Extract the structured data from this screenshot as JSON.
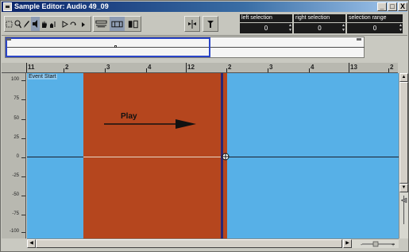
{
  "window": {
    "title": "Sample Editor: Audio 49_09",
    "minimize_label": "_",
    "maximize_label": "□",
    "close_label": "X"
  },
  "toolbar": {
    "tools": [
      {
        "name": "range-select-icon",
        "glyph": "⬚"
      },
      {
        "name": "zoom-icon",
        "glyph": "🔍"
      },
      {
        "name": "pencil-icon",
        "glyph": "✎"
      },
      {
        "name": "play-tool-icon",
        "glyph": "◁"
      },
      {
        "name": "scrub-icon",
        "glyph": "✋"
      },
      {
        "name": "audition-icon",
        "glyph": "♫"
      }
    ],
    "left_selection": {
      "label": "left selection",
      "value": "0"
    },
    "right_selection": {
      "label": "right selection",
      "value": "0"
    },
    "selection_range": {
      "label": "selection range",
      "value": "0"
    }
  },
  "ruler": {
    "marks": [
      "11",
      "2",
      "3",
      "4",
      "12",
      "2",
      "3",
      "4",
      "13",
      "2"
    ]
  },
  "scale": {
    "labels": [
      "100",
      "75",
      "50",
      "25",
      "0",
      "-25",
      "-50",
      "-75",
      "-100"
    ]
  },
  "wave": {
    "event_start_label": "Event Start",
    "play_label": "Play"
  },
  "colors": {
    "wave_background": "#57b0e7",
    "selection": "#b5461e",
    "playhead": "#2a2675",
    "overview_view_border": "#2b45c8"
  }
}
